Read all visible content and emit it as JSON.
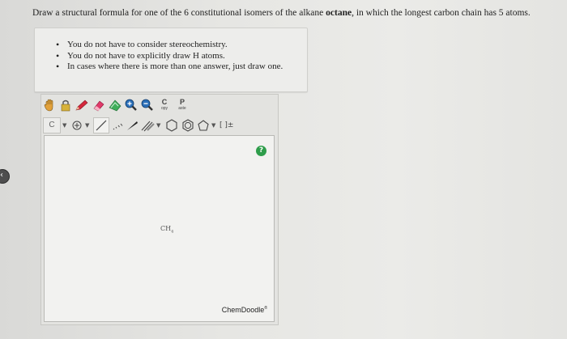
{
  "question": {
    "before": "Draw a structural formula for one of the 6 constitutional isomers of the alkane ",
    "emph": "octane",
    "after": ", in which the longest carbon chain has 5 atoms."
  },
  "notes": [
    "You do not have to consider stereochemistry.",
    "You do not have to explicitly draw H atoms.",
    "In cases where there is more than one answer, just draw one."
  ],
  "toolbar": {
    "copy_big": "C",
    "copy_small": "opy",
    "paste_big": "P",
    "paste_small": "aste",
    "element_label": "C",
    "charge_label": "[ ]±"
  },
  "canvas": {
    "atom_label": "CH",
    "atom_subscript": "4",
    "help_label": "?"
  },
  "brand": "ChemDoodle",
  "colors": {
    "help": "#2e9d4a",
    "pencil": "#d4283c",
    "eraser": "#e03a6a",
    "lasso": "#3fae5a"
  }
}
